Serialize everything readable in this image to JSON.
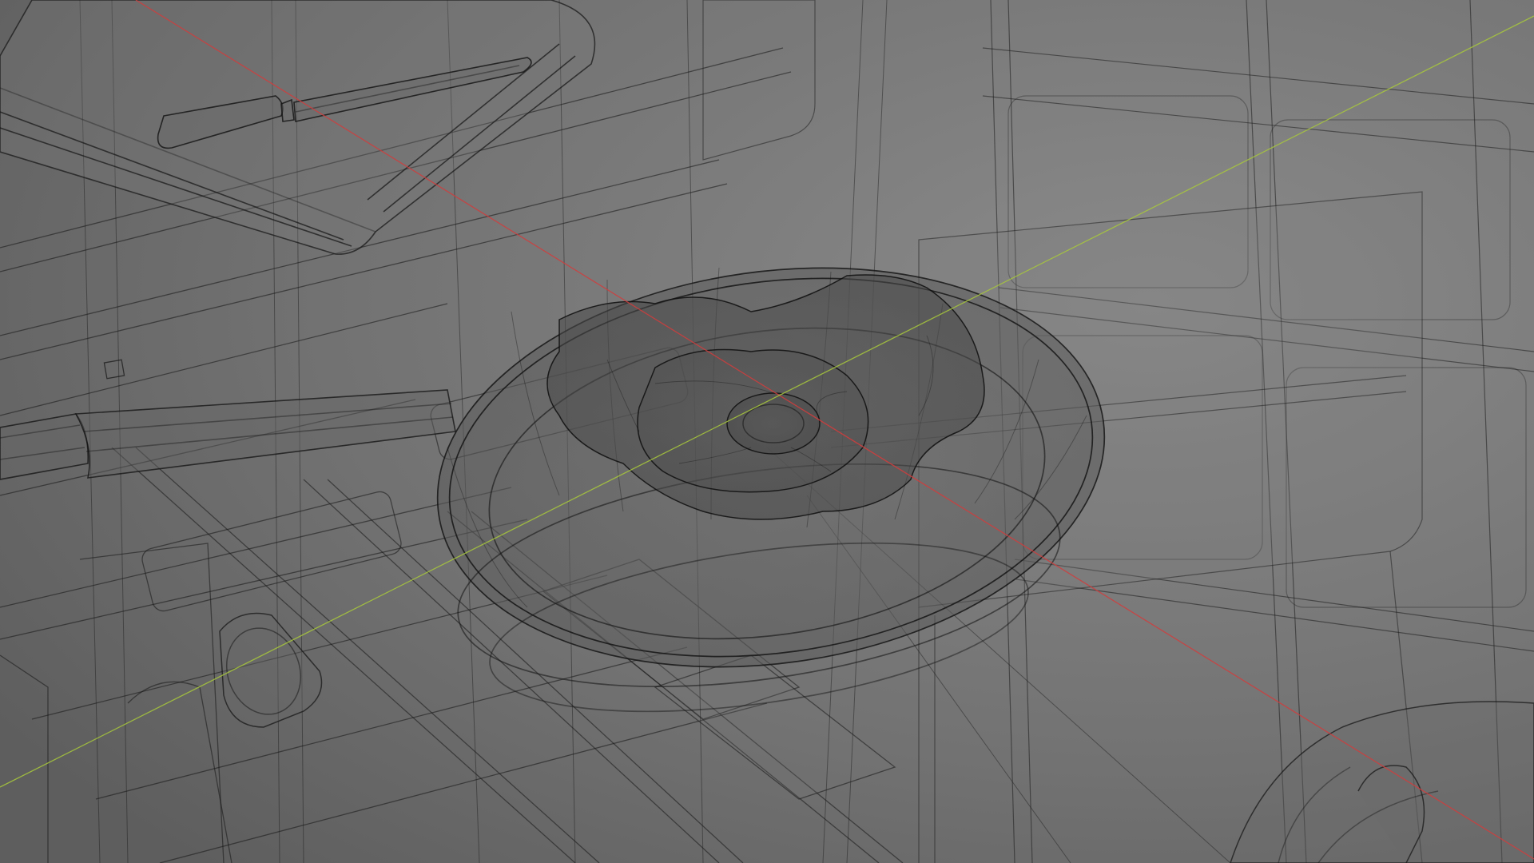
{
  "viewport": {
    "mode": "wireframe",
    "background": "#6e6e6e",
    "wire_color": "#141414",
    "x_axis_color": "#d23c3c",
    "y_axis_color": "#a8c83c"
  },
  "scene": {
    "objects": [
      "cutting-board",
      "knife",
      "frying-pan",
      "fried-egg",
      "pan-handle",
      "stove-grate",
      "stove-knob",
      "cabinet",
      "wall-tiles",
      "pot"
    ]
  }
}
